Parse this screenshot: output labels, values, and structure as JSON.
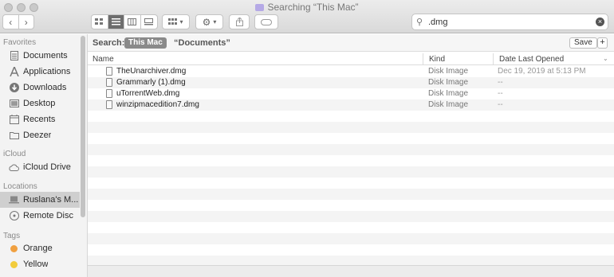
{
  "window": {
    "title": "Searching “This Mac”"
  },
  "toolbar": {
    "back_icon": "chevron-left-icon",
    "forward_icon": "chevron-right-icon",
    "view_modes": [
      "icon-view",
      "list-view",
      "column-view",
      "gallery-view"
    ],
    "active_view": "list-view",
    "group_icon": "grid-icon",
    "action_icon": "gear-icon",
    "share_icon": "share-icon",
    "tag_icon": "tag-icon"
  },
  "search": {
    "value": ".dmg"
  },
  "scope": {
    "label": "Search:",
    "this_mac": "This Mac",
    "documents": "“Documents”",
    "save": "Save",
    "add": "+"
  },
  "sidebar": {
    "favorites_header": "Favorites",
    "favorites": [
      {
        "label": "Documents",
        "icon": "document-icon"
      },
      {
        "label": "Applications",
        "icon": "applications-icon"
      },
      {
        "label": "Downloads",
        "icon": "downloads-icon"
      },
      {
        "label": "Desktop",
        "icon": "desktop-icon"
      },
      {
        "label": "Recents",
        "icon": "recents-icon"
      },
      {
        "label": "Deezer",
        "icon": "folder-icon"
      }
    ],
    "icloud_header": "iCloud",
    "icloud": [
      {
        "label": "iCloud Drive",
        "icon": "cloud-icon"
      }
    ],
    "locations_header": "Locations",
    "locations": [
      {
        "label": "Ruslana's M...",
        "icon": "laptop-icon"
      },
      {
        "label": "Remote Disc",
        "icon": "disc-icon"
      }
    ],
    "tags_header": "Tags",
    "tags": [
      {
        "label": "Orange",
        "color": "#f0a040"
      },
      {
        "label": "Yellow",
        "color": "#f2cc3c"
      }
    ]
  },
  "columns": {
    "name": "Name",
    "kind": "Kind",
    "date": "Date Last Opened"
  },
  "files": [
    {
      "name": "TheUnarchiver.dmg",
      "kind": "Disk Image",
      "date": "Dec 19, 2019 at 5:13 PM"
    },
    {
      "name": "Grammarly (1).dmg",
      "kind": "Disk Image",
      "date": "--"
    },
    {
      "name": "uTorrentWeb.dmg",
      "kind": "Disk Image",
      "date": "--"
    },
    {
      "name": "winzipmacedition7.dmg",
      "kind": "Disk Image",
      "date": "--"
    }
  ]
}
